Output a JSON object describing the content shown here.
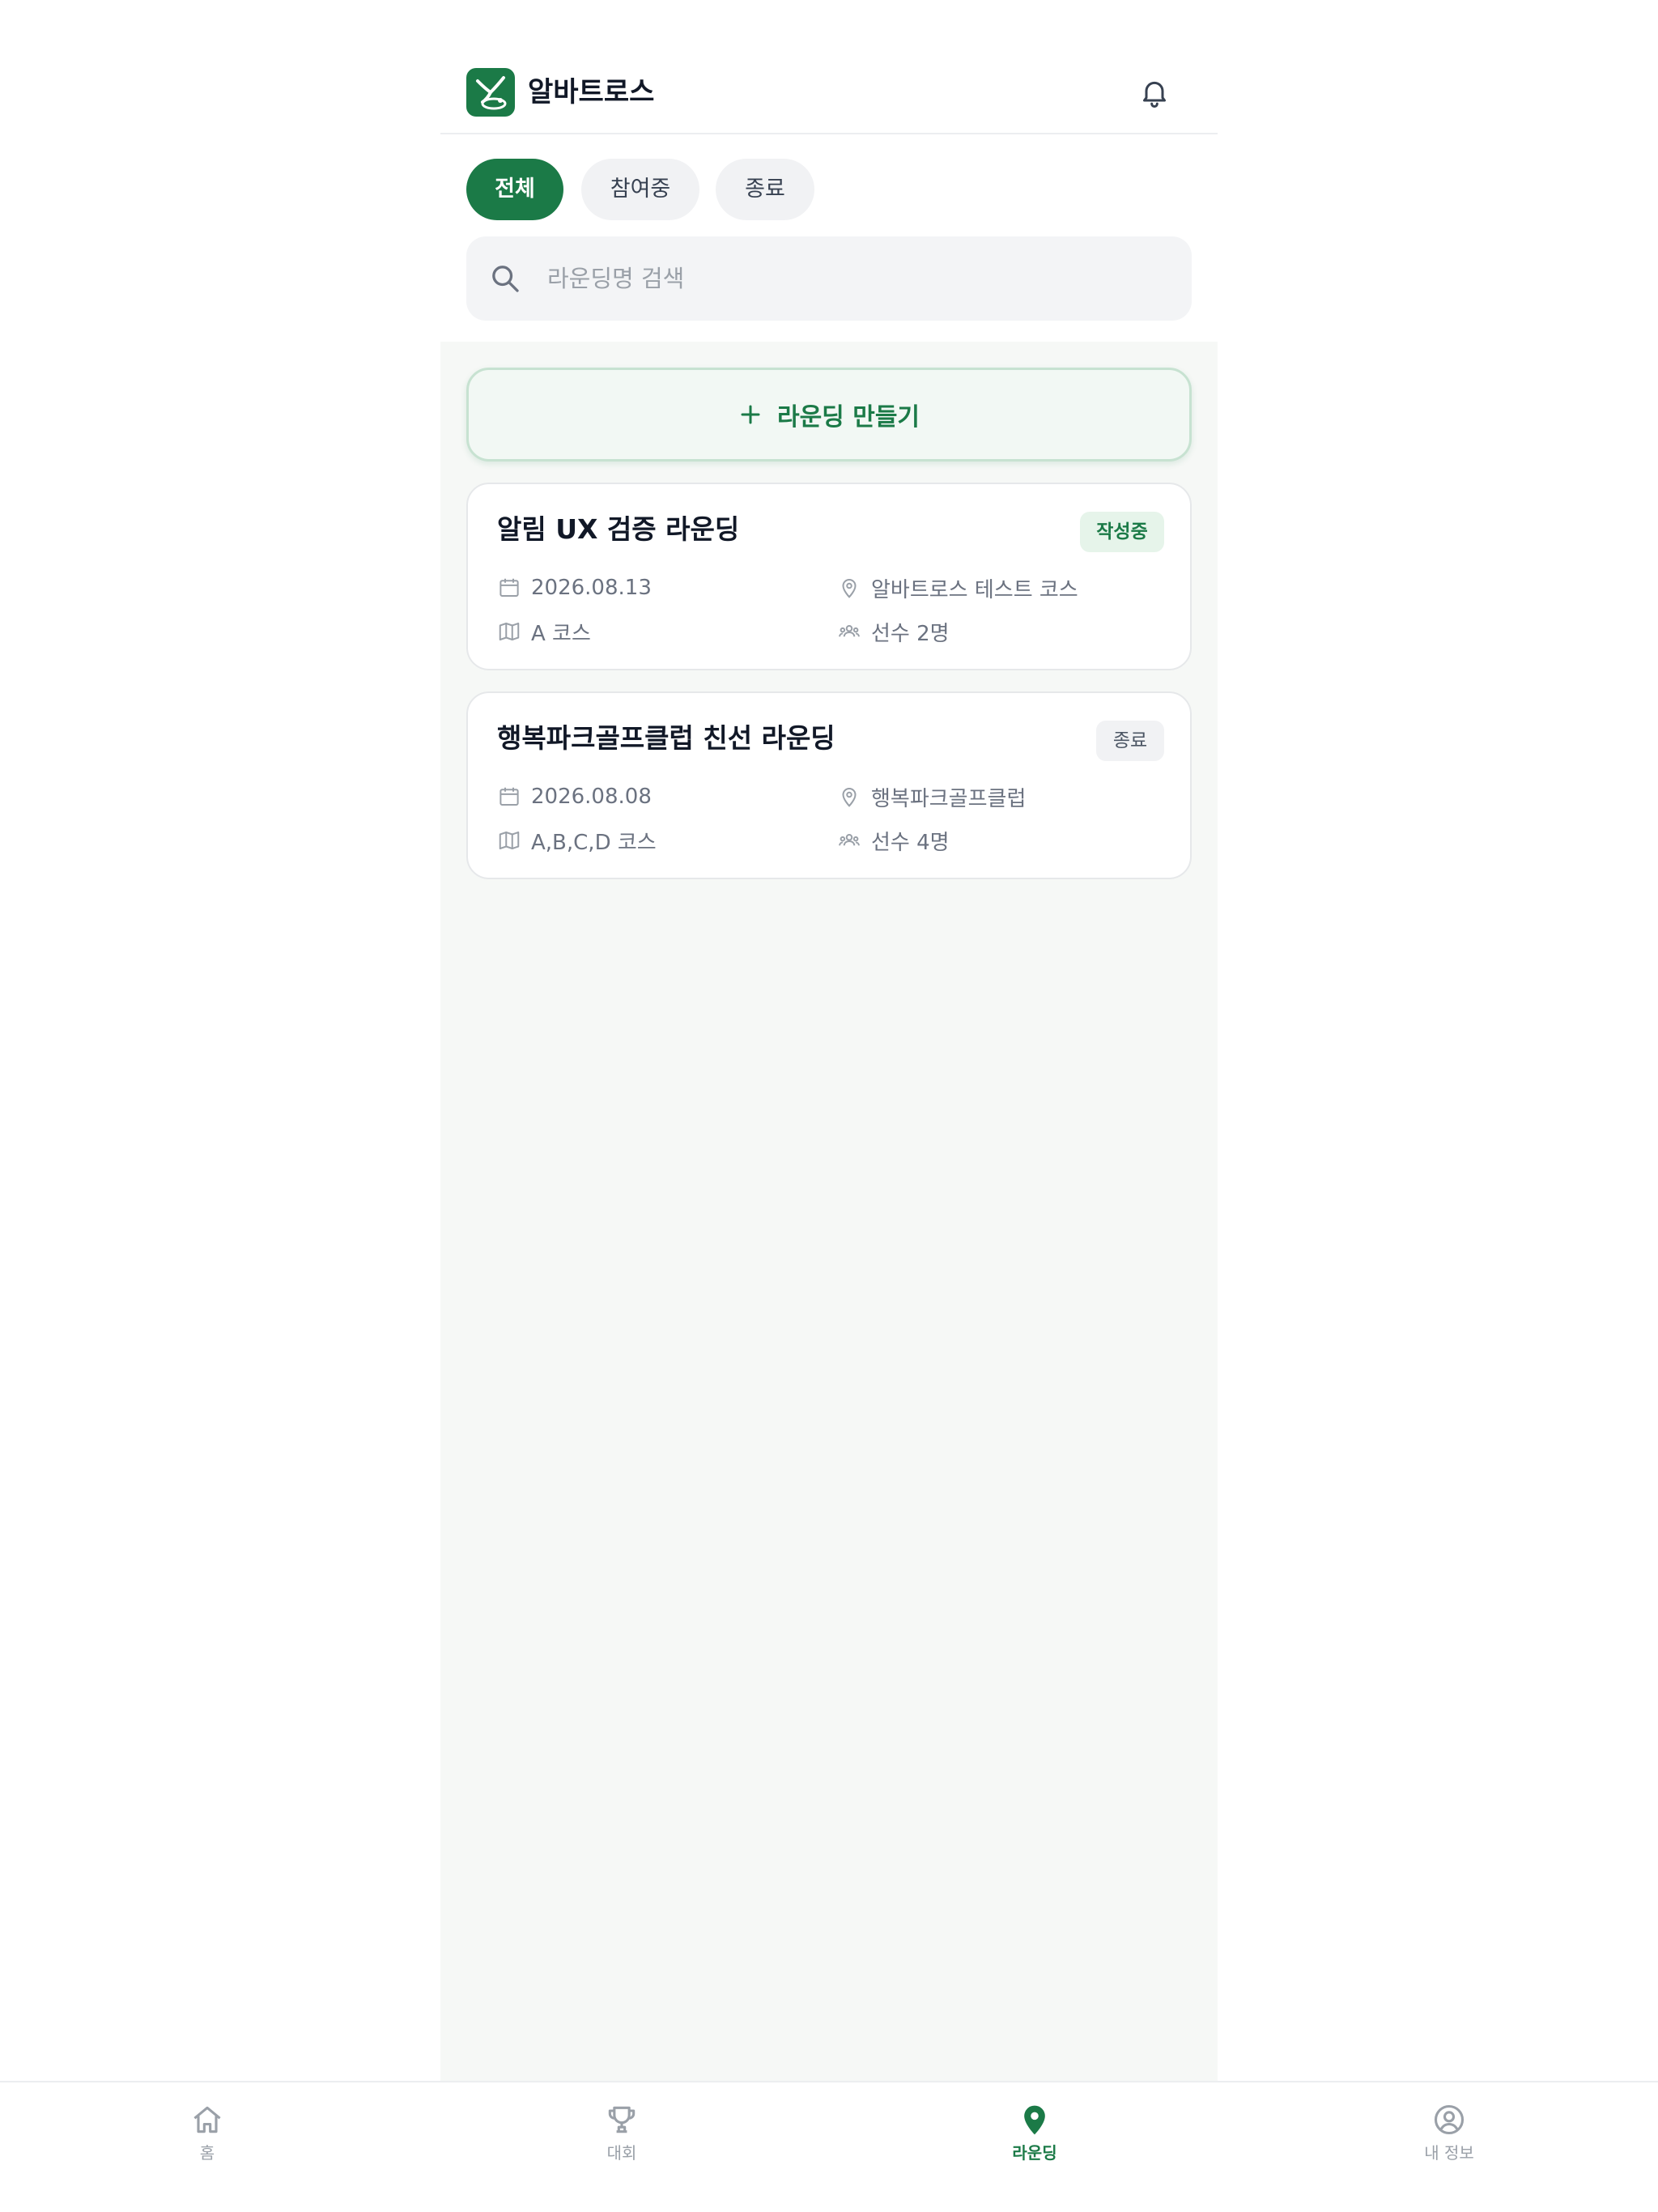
{
  "header": {
    "app_title": "알바트로스",
    "logo_icon": "golf-bird-logo",
    "notification_icon": "bell-icon"
  },
  "filters": [
    {
      "label": "전체",
      "active": true
    },
    {
      "label": "참여중",
      "active": false
    },
    {
      "label": "종료",
      "active": false
    }
  ],
  "search": {
    "placeholder": "라운딩명 검색",
    "value": ""
  },
  "create_button": {
    "label": "라운딩 만들기"
  },
  "rounds": [
    {
      "title": "알림 UX 검증 라운딩",
      "status": "작성중",
      "date": "2026.08.13",
      "location": "알바트로스 테스트 코스",
      "course": "A 코스",
      "players": "선수 2명"
    },
    {
      "title": "행복파크골프클럽 친선 라운딩",
      "status": "종료",
      "date": "2026.08.08",
      "location": "행복파크골프클럽",
      "course": "A,B,C,D 코스",
      "players": "선수 4명"
    }
  ],
  "bottom_nav": [
    {
      "label": "홈",
      "icon": "home-icon",
      "active": false
    },
    {
      "label": "대회",
      "icon": "trophy-icon",
      "active": false
    },
    {
      "label": "라운딩",
      "icon": "map-pin-icon",
      "active": true
    },
    {
      "label": "내 정보",
      "icon": "user-circle-icon",
      "active": false
    }
  ],
  "colors": {
    "brand": "#1b7a47",
    "background": "#f6f8f6",
    "muted_text": "#6b7280"
  }
}
